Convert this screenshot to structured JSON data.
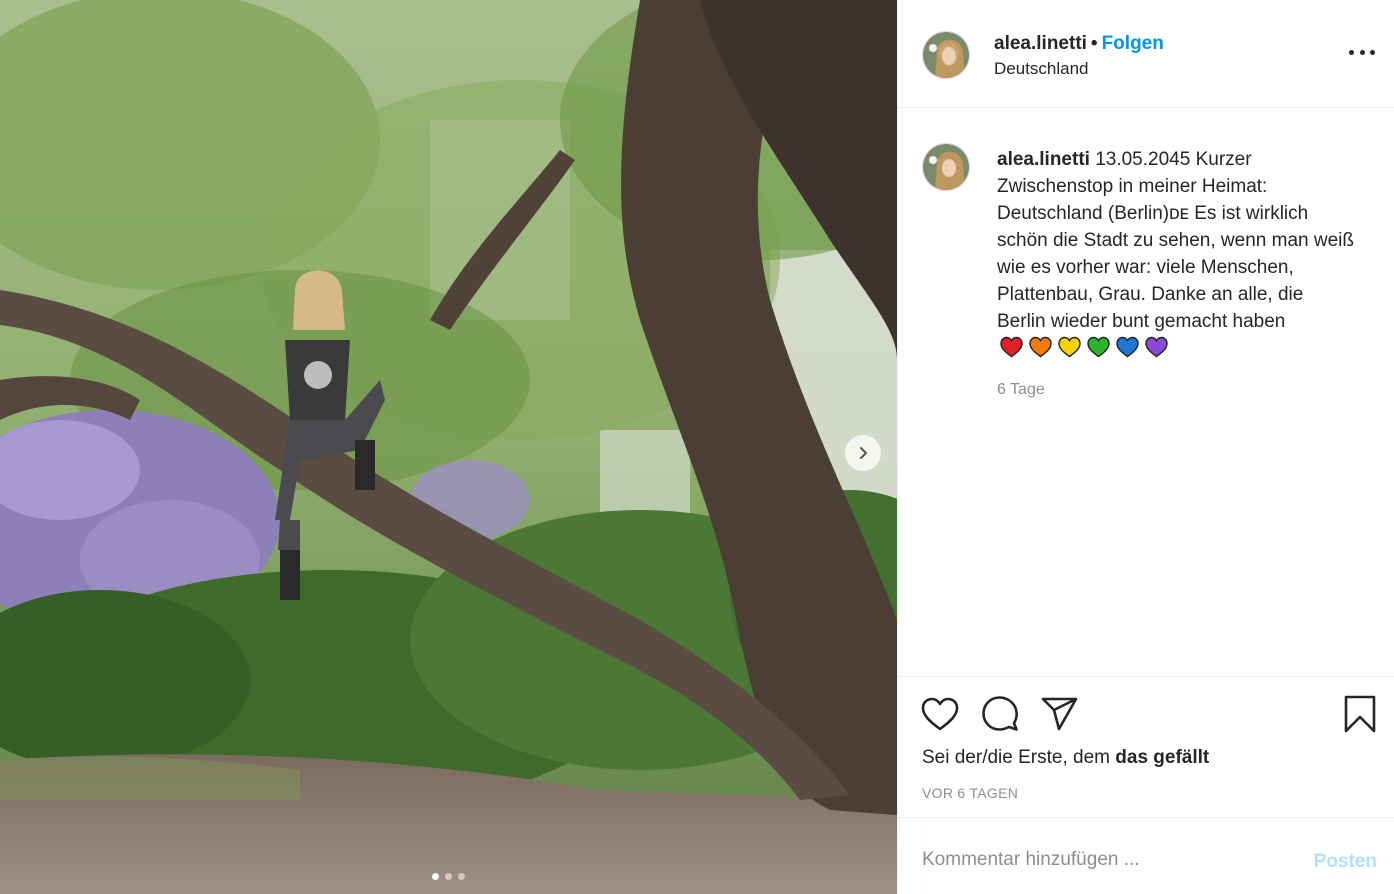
{
  "post": {
    "username": "alea.linetti",
    "separator": "•",
    "follow_label": "Folgen",
    "location": "Deutschland",
    "date": "13.05.2045",
    "caption": "Kurzer Zwischenstop in meiner Heimat: Deutschland (Berlin)ᴅᴇ Es ist wirklich schön die Stadt zu sehen, wenn man weiß wie es vorher war: viele Menschen, Plattenbau, Grau. Danke an alle, die Berlin wieder bunt gemacht haben",
    "caption_ago": "6 Tage",
    "likes_prefix": "Sei der/die Erste, dem ",
    "likes_bold": "das gefällt",
    "timestamp": "VOR 6 TAGEN"
  },
  "hearts": [
    "#e0202a",
    "#f47a0c",
    "#f7d10a",
    "#2cb52a",
    "#1f78d6",
    "#8a4ad6"
  ],
  "comment": {
    "placeholder": "Kommentar hinzufügen ...",
    "post_label": "Posten"
  },
  "carousel": {
    "count": 3,
    "active": 0
  },
  "icons": {
    "more": "more-options-icon",
    "like": "heart-icon",
    "comment": "comment-icon",
    "share": "send-icon",
    "save": "bookmark-icon",
    "next": "chevron-right-icon"
  },
  "colors": {
    "link": "#0095f6",
    "post_disabled": "#b2dffc",
    "muted": "#8e8e8e"
  }
}
